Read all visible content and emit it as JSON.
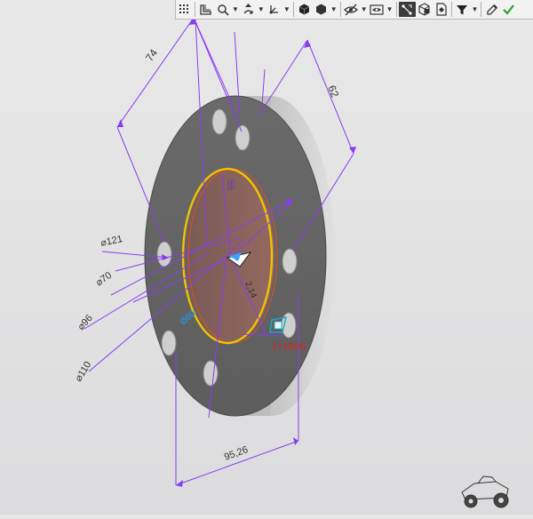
{
  "toolbar": {
    "buttons": [
      {
        "name": "grid-icon"
      },
      {
        "name": "sketch-plane-icon"
      },
      {
        "name": "zoom-icon",
        "dropdown": true
      },
      {
        "name": "pan-rotate-icon",
        "dropdown": true
      },
      {
        "name": "orientation-icon",
        "dropdown": true
      },
      {
        "name": "cube-view-icon"
      },
      {
        "name": "shaded-display-icon",
        "dropdown": true
      },
      {
        "name": "hide-icon",
        "dropdown": true
      },
      {
        "name": "visibility-icon",
        "dropdown": true
      },
      {
        "name": "constraints-icon"
      },
      {
        "name": "section-view-icon"
      },
      {
        "name": "document-icon"
      },
      {
        "name": "filter-icon",
        "dropdown": true
      },
      {
        "name": "eyedropper-icon"
      },
      {
        "name": "confirm-check-icon"
      }
    ]
  },
  "dimensions": {
    "angular_top": "74",
    "right_side": "62",
    "inner_vertical": "55",
    "diameter_121": "⌀121",
    "diameter_70": "⌀70",
    "diameter_96": "⌀96",
    "diameter_110": "⌀110",
    "bottom_width": "95,26",
    "diag_inner": "2,14",
    "red_label": "1×18(4)",
    "blue_label": "Ø80"
  },
  "colors": {
    "dimension_line": "#8a3cf0",
    "flange_face": "#6b6b6b",
    "flange_edge": "#c9c9c9",
    "bore_outline": "#f2c200",
    "bore_fill": "#8c5e55",
    "red_text": "#e02020",
    "blue_text": "#2a8fd6",
    "check_green": "#2aa02a"
  }
}
